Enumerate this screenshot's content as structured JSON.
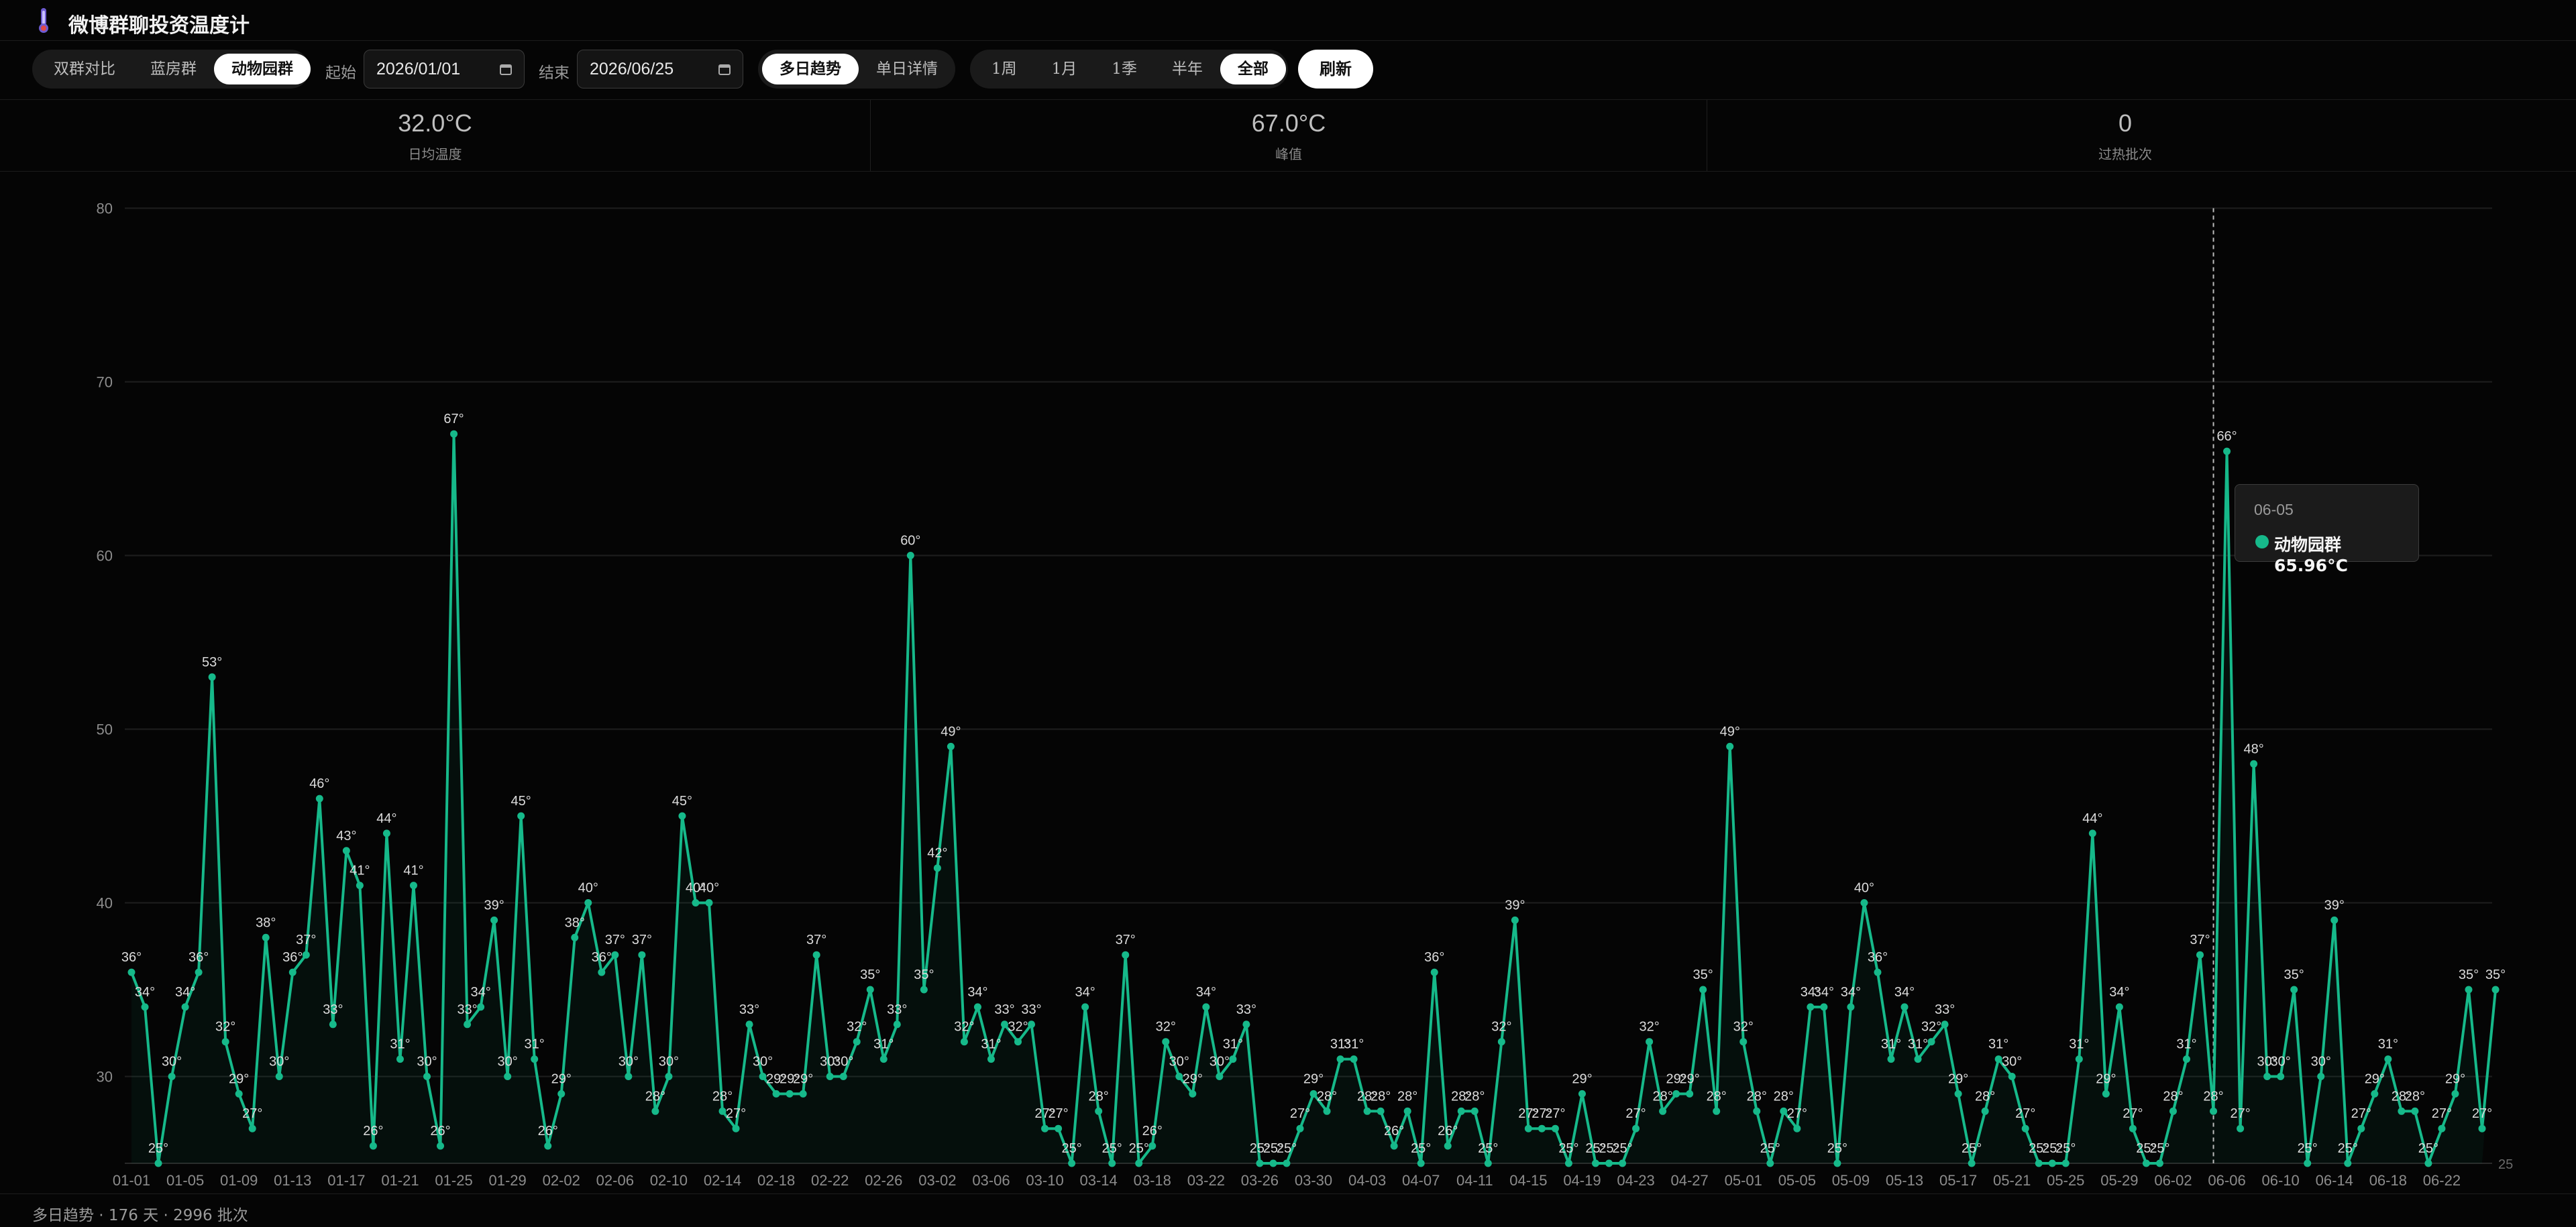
{
  "header": {
    "title": "微博群聊投资温度计",
    "icon": "thermometer-icon"
  },
  "toolbar": {
    "groups": [
      {
        "label": "双群对比",
        "active": false
      },
      {
        "label": "蓝房群",
        "active": false
      },
      {
        "label": "动物园群",
        "active": true
      }
    ],
    "start_label": "起始",
    "start_date": "2026/01/01",
    "end_label": "结束",
    "end_date": "2026/06/25",
    "modes": [
      {
        "label": "多日趋势",
        "active": true
      },
      {
        "label": "单日详情",
        "active": false
      }
    ],
    "ranges": [
      {
        "label": "1周",
        "active": false
      },
      {
        "label": "1月",
        "active": false
      },
      {
        "label": "1季",
        "active": false
      },
      {
        "label": "半年",
        "active": false
      },
      {
        "label": "全部",
        "active": true
      }
    ],
    "refresh_label": "刷新"
  },
  "stats": [
    {
      "value": "32.0°C",
      "label": "日均温度"
    },
    {
      "value": "67.0°C",
      "label": "峰值"
    },
    {
      "value": "0",
      "label": "过热批次"
    }
  ],
  "tooltip": {
    "date": "06-05",
    "series": "动物园群",
    "value": "65.96°C"
  },
  "footer": {
    "text": "多日趋势 · 176 天 · 2996 批次"
  },
  "colors": {
    "line": "#16b98a",
    "background": "#050505",
    "grid": "#1e1e1e"
  },
  "chart_data": {
    "type": "line",
    "title": "",
    "xlabel": "",
    "ylabel": "",
    "ylim": [
      25,
      80
    ],
    "yticks": [
      25,
      30,
      40,
      50,
      60,
      70,
      80
    ],
    "ytick_labels_left": [
      "30",
      "40",
      "50",
      "60",
      "70",
      "80"
    ],
    "ytick_label_right": "25",
    "hover_index": 155,
    "x": [
      "01-01",
      "01-02",
      "01-03",
      "01-04",
      "01-05",
      "01-06",
      "01-07",
      "01-08",
      "01-09",
      "01-10",
      "01-11",
      "01-12",
      "01-13",
      "01-14",
      "01-15",
      "01-16",
      "01-17",
      "01-18",
      "01-19",
      "01-20",
      "01-21",
      "01-22",
      "01-23",
      "01-24",
      "01-25",
      "01-26",
      "01-27",
      "01-28",
      "01-29",
      "01-30",
      "01-31",
      "02-01",
      "02-02",
      "02-03",
      "02-04",
      "02-05",
      "02-06",
      "02-07",
      "02-08",
      "02-09",
      "02-10",
      "02-11",
      "02-12",
      "02-13",
      "02-14",
      "02-15",
      "02-16",
      "02-17",
      "02-18",
      "02-19",
      "02-20",
      "02-21",
      "02-22",
      "02-23",
      "02-24",
      "02-25",
      "02-26",
      "02-27",
      "02-28",
      "03-01",
      "03-02",
      "03-03",
      "03-04",
      "03-05",
      "03-06",
      "03-07",
      "03-08",
      "03-09",
      "03-10",
      "03-11",
      "03-12",
      "03-13",
      "03-14",
      "03-15",
      "03-16",
      "03-17",
      "03-18",
      "03-19",
      "03-20",
      "03-21",
      "03-22",
      "03-23",
      "03-24",
      "03-25",
      "03-26",
      "03-27",
      "03-28",
      "03-29",
      "03-30",
      "03-31",
      "04-01",
      "04-02",
      "04-03",
      "04-04",
      "04-05",
      "04-06",
      "04-07",
      "04-08",
      "04-09",
      "04-10",
      "04-11",
      "04-12",
      "04-13",
      "04-14",
      "04-15",
      "04-16",
      "04-17",
      "04-18",
      "04-19",
      "04-20",
      "04-21",
      "04-22",
      "04-23",
      "04-24",
      "04-25",
      "04-26",
      "04-27",
      "04-28",
      "04-29",
      "04-30",
      "05-01",
      "05-02",
      "05-03",
      "05-04",
      "05-05",
      "05-06",
      "05-07",
      "05-08",
      "05-09",
      "05-10",
      "05-11",
      "05-12",
      "05-13",
      "05-14",
      "05-15",
      "05-16",
      "05-17",
      "05-18",
      "05-19",
      "05-20",
      "05-21",
      "05-22",
      "05-23",
      "05-24",
      "05-25",
      "05-26",
      "05-27",
      "05-28",
      "05-29",
      "05-30",
      "05-31",
      "06-01",
      "06-02",
      "06-03",
      "06-04",
      "06-05",
      "06-06",
      "06-07",
      "06-08",
      "06-09",
      "06-10",
      "06-11",
      "06-12",
      "06-13",
      "06-14",
      "06-15",
      "06-16",
      "06-17",
      "06-18",
      "06-19",
      "06-20",
      "06-21",
      "06-22",
      "06-23",
      "06-24",
      "06-25"
    ],
    "xtick_labels": [
      "01-01",
      "01-05",
      "01-09",
      "01-13",
      "01-17",
      "01-21",
      "01-25",
      "01-29",
      "02-02",
      "02-06",
      "02-10",
      "02-14",
      "02-18",
      "02-22",
      "02-26",
      "03-02",
      "03-06",
      "03-10",
      "03-14",
      "03-18",
      "03-22",
      "03-26",
      "03-30",
      "04-03",
      "04-07",
      "04-11",
      "04-15",
      "04-19",
      "04-23",
      "04-27",
      "05-01",
      "05-05",
      "05-09",
      "05-13",
      "05-17",
      "05-21",
      "05-25",
      "05-29",
      "06-02",
      "06-06",
      "06-10",
      "06-14",
      "06-18",
      "06-22"
    ],
    "series": [
      {
        "name": "动物园群",
        "values": [
          36,
          34,
          25,
          30,
          34,
          36,
          53,
          32,
          29,
          27,
          38,
          30,
          36,
          37,
          46,
          33,
          43,
          41,
          26,
          44,
          31,
          41,
          30,
          26,
          67,
          33,
          34,
          39,
          30,
          45,
          31,
          26,
          29,
          38,
          40,
          36,
          37,
          30,
          37,
          28,
          30,
          45,
          40,
          40,
          28,
          27,
          33,
          30,
          29,
          29,
          29,
          37,
          30,
          30,
          32,
          35,
          31,
          33,
          60,
          35,
          42,
          49,
          32,
          34,
          31,
          33,
          32,
          33,
          27,
          27,
          25,
          34,
          28,
          25,
          37,
          25,
          26,
          32,
          30,
          29,
          34,
          30,
          31,
          33,
          25,
          25,
          25,
          27,
          29,
          28,
          31,
          31,
          28,
          28,
          26,
          28,
          25,
          36,
          26,
          28,
          28,
          25,
          32,
          39,
          27,
          27,
          27,
          25,
          29,
          25,
          25,
          25,
          27,
          32,
          28,
          29,
          29,
          35,
          28,
          49,
          32,
          28,
          25,
          28,
          27,
          34,
          34,
          25,
          34,
          40,
          36,
          31,
          34,
          31,
          32,
          33,
          29,
          25,
          28,
          31,
          30,
          27,
          25,
          25,
          25,
          31,
          44,
          29,
          34,
          27,
          25,
          25,
          28,
          31,
          37,
          28,
          66,
          27,
          48,
          30,
          30,
          35,
          25,
          30,
          39,
          25,
          27,
          29,
          31,
          28,
          28,
          25,
          27,
          29,
          35,
          27,
          35
        ]
      }
    ],
    "legend": "none",
    "grid": true
  }
}
